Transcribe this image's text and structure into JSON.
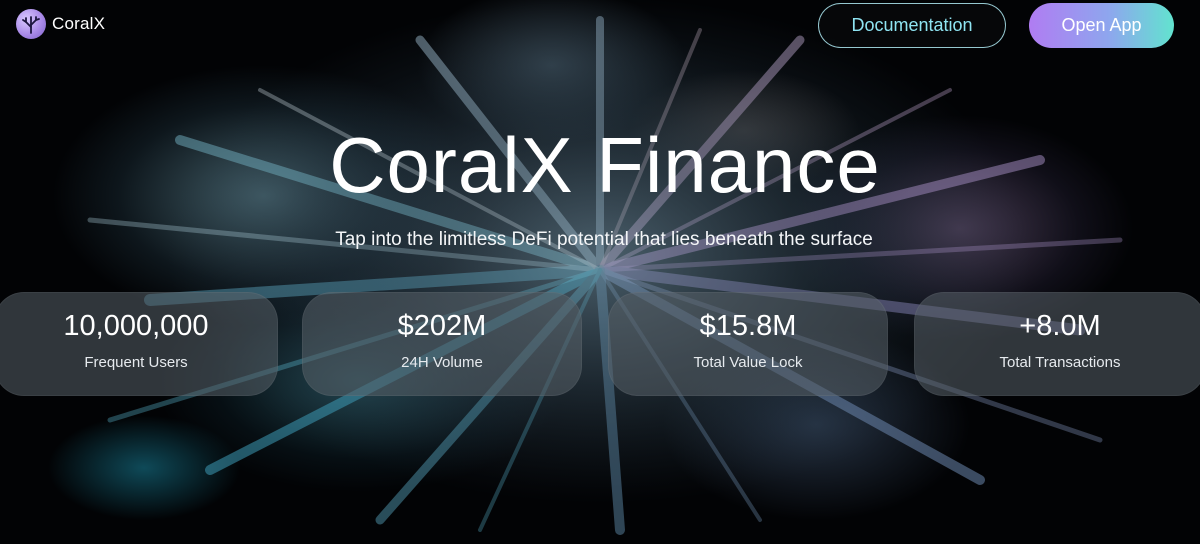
{
  "brand": {
    "name": "CoralX",
    "logo_icon": "coral-logo-icon",
    "accent_gradient": [
      "#b07cf2",
      "#8ea6ee",
      "#62e3cf"
    ]
  },
  "header": {
    "documentation_label": "Documentation",
    "open_app_label": "Open App"
  },
  "hero": {
    "title": "CoralX Finance",
    "subtitle": "Tap into the limitless DeFi potential that lies beneath the surface"
  },
  "stats": [
    {
      "value": "10,000,000",
      "label": "Frequent Users"
    },
    {
      "value": "$202M",
      "label": "24H Volume"
    },
    {
      "value": "$15.8M",
      "label": "Total Value Lock"
    },
    {
      "value": "+8.0M",
      "label": "Total Transactions"
    }
  ]
}
